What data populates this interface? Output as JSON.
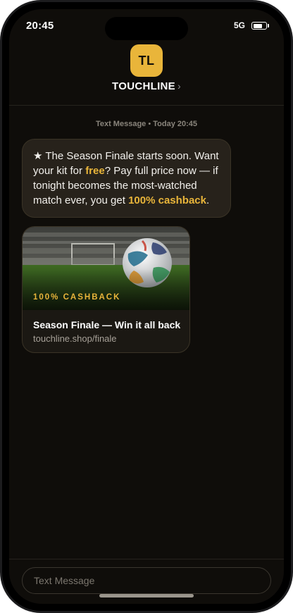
{
  "status_bar": {
    "time": "20:45",
    "network": "5G",
    "battery_level": 0.8
  },
  "header": {
    "avatar_initials": "TL",
    "sender_name": "TOUCHLINE",
    "chevron": "›"
  },
  "thread": {
    "meta_label": "Text Message",
    "meta_separator": " • ",
    "meta_time": "Today 20:45"
  },
  "message": {
    "star": "★",
    "part1": " The Season Finale starts soon. Want your kit for ",
    "free": "free",
    "part2": "? Pay full price now — if tonight becomes the most-watched match ever, you get ",
    "cashback": "100% cashback",
    "part3": "."
  },
  "link_card": {
    "overlay_label": "100% CASHBACK",
    "title": "Season Finale — Win it all back",
    "url": "touchline.shop/finale"
  },
  "composer": {
    "placeholder": "Text Message"
  },
  "colors": {
    "accent": "#e9b53a",
    "background": "#0f0d0a",
    "bubble": "#27221b"
  }
}
